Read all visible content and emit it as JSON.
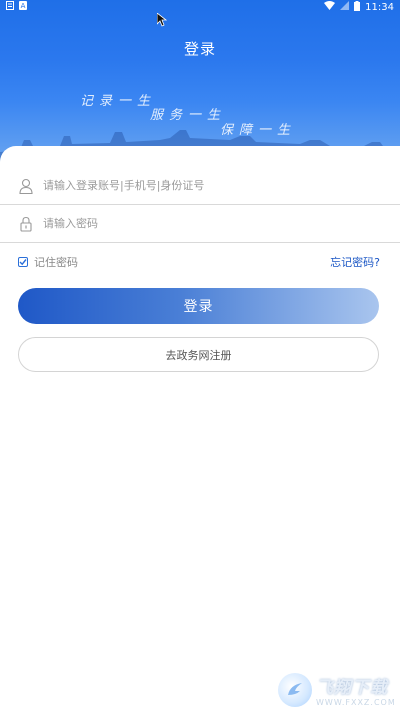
{
  "status_bar": {
    "time": "11:34"
  },
  "header": {
    "title": "登录",
    "slogans": [
      "记录一生",
      "服务一生",
      "保障一生"
    ]
  },
  "form": {
    "account_placeholder": "请输入登录账号|手机号|身份证号",
    "password_placeholder": "请输入密码",
    "remember_label": "记住密码",
    "remember_checked": true,
    "forgot_label": "忘记密码?",
    "login_button": "登录",
    "register_button": "去政务网注册"
  },
  "watermark": {
    "main": "飞翔下载",
    "sub": "WWW.FXXZ.COM"
  },
  "colors": {
    "primary": "#1f58c7",
    "link": "#1a56c5",
    "hero_top": "#1f6fe8"
  }
}
